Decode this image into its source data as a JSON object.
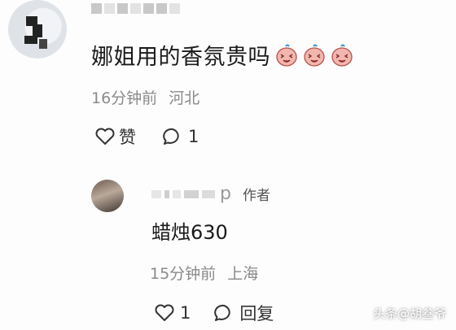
{
  "top_comment": {
    "text": "娜姐用的香氛贵吗",
    "emoji_icon": "laughing-face-icon",
    "emoji_count": 3,
    "time": "16分钟前",
    "location": "河北",
    "like_label": "赞",
    "reply_count": "1"
  },
  "reply": {
    "name_visible": "p",
    "author_badge": "作者",
    "text": "蜡烛630",
    "time": "15分钟前",
    "location": "上海",
    "like_count": "1",
    "reply_label": "回复"
  },
  "watermark": "头条@胡叁爷",
  "colors": {
    "meta_gray": "#8a8a8a",
    "text": "#1a1a1a",
    "emoji_peach": "#f3b6ae",
    "emoji_blue": "#3a8fd0"
  }
}
